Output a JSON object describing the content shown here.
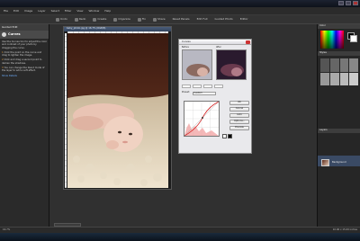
{
  "title_bar": {
    "title": ""
  },
  "menu": [
    "File",
    "Edit",
    "Image",
    "Layer",
    "Select",
    "Filter",
    "View",
    "Window",
    "Help"
  ],
  "toolbar": {
    "items": [
      "Undo",
      "Redo",
      "Create",
      "Organize",
      "Fix",
      "Share",
      "Reset Panels",
      "Edit Full",
      "Guided Photo",
      "Editor"
    ]
  },
  "left_panel": {
    "header": "Guided Edit",
    "section_title": "Curves",
    "intro": "Use the Curves tool to adjust the color and contrast of your photo by dragging the curve.",
    "steps": [
      {
        "num": "1",
        "text": "Click the point on the curve and drag to lighten the image."
      },
      {
        "num": "2",
        "text": "Click and drag a second point to darken the shadows."
      },
      {
        "num": "3",
        "text": "You can change the blend mode of the layer to add a soft effect."
      }
    ],
    "more": "Show Details"
  },
  "document": {
    "title": "baby_photo.jpg @ 16.7% (RGB/8)"
  },
  "dialog": {
    "title": "Curves",
    "before_label": "Before",
    "after_label": "After",
    "preset_label": "Preset:",
    "preset_value": "Custom",
    "buttons": [
      "OK",
      "Cancel",
      "Auto",
      "Options...",
      "Preview"
    ]
  },
  "right_panel": {
    "color_header": "Color",
    "styles_header": "Styles",
    "layers_header": "Layers",
    "layer_name": "Background"
  },
  "status": {
    "left": "16.7%",
    "right": "10.06 x 15.09 inches"
  },
  "colors": {
    "accent": "#e8a13a",
    "link": "#6fb0ff",
    "curve_red": "#d22020"
  }
}
